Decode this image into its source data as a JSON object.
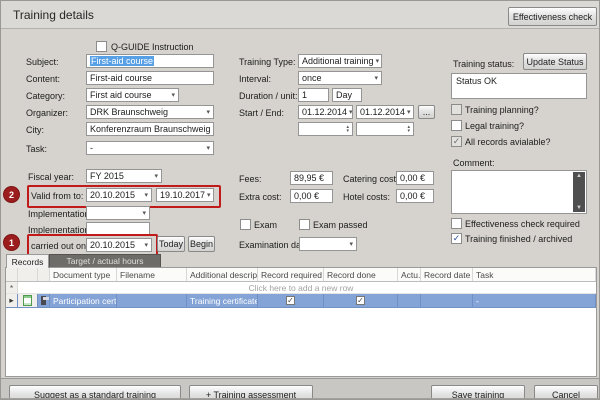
{
  "window": {
    "title": "Training details",
    "effectiveness_check_button": "Effectiveness check"
  },
  "form": {
    "qguide_label": "Q-GUIDE Instruction",
    "left": {
      "subject_label": "Subject:",
      "subject_value": "First-aid course",
      "content_label": "Content:",
      "content_value": "First-aid course",
      "category_label": "Category:",
      "category_value": "First aid course",
      "organizer_label": "Organizer:",
      "organizer_value": "DRK Braunschweig",
      "city_label": "City:",
      "city_value": "Konferenzraum Braunschweig",
      "task_label": "Task:",
      "task_value": "-",
      "fiscal_year_label": "Fiscal year:",
      "fiscal_year_value": "FY 2015",
      "valid_label": "Valid from to:",
      "valid_from": "20.10.2015",
      "valid_to": "19.10.2017",
      "implementation_to_label": "Implementation to:",
      "implementation_by_label": "Implementation by:",
      "carried_out_label": "carried out on:",
      "carried_out_value": "20.10.2015",
      "today_button": "Today",
      "begin_button": "Begin"
    },
    "middle": {
      "training_type_label": "Training Type:",
      "training_type_value": "Additional training",
      "interval_label": "Interval:",
      "interval_value": "once",
      "duration_label": "Duration / unit:",
      "duration_value": "1",
      "unit_value": "Day",
      "start_end_label": "Start / End:",
      "start_value": "01.12.2014",
      "end_value": "01.12.2014",
      "more_button": "...",
      "fees_label": "Fees:",
      "fees_value": "89,95 €",
      "extra_cost_label": "Extra cost:",
      "extra_cost_value": "0,00 €",
      "catering_label": "Catering costs:",
      "catering_value": "0,00 €",
      "hotel_label": "Hotel costs:",
      "hotel_value": "0,00 €",
      "exam_label": "Exam",
      "exam_passed_label": "Exam passed",
      "examination_date_label": "Examination date:"
    },
    "right": {
      "training_status_label": "Training status:",
      "update_status_button": "Update Status",
      "status_value": "Status OK",
      "training_planning_label": "Training planning?",
      "legal_training_label": "Legal training?",
      "all_records_label": "All records avialable?",
      "comment_label": "Comment:",
      "effectiveness_required_label": "Effectiveness check required",
      "finished_archived_label": "Training finished / archived"
    }
  },
  "annotations": {
    "marker1": "1",
    "marker2": "2"
  },
  "records": {
    "tabs": {
      "records": "Records",
      "target": "Target / actual hours"
    },
    "columns": {
      "document_type": "Document type",
      "filename": "Filename",
      "additional_description": "Additional description",
      "record_required": "Record required",
      "record_done": "Record done",
      "actual": "Actu...",
      "record_date": "Record date",
      "task": "Task"
    },
    "new_row_hint": "Click here to add a new row",
    "new_row_indicator": "*",
    "row_indicator": "▸",
    "rows": [
      {
        "document_type": "Participation certificate",
        "filename": "",
        "additional_description": "Training certificate",
        "record_required": true,
        "record_done": true,
        "actual": "",
        "record_date": "",
        "task": "-"
      }
    ]
  },
  "footer": {
    "suggest_button": "Suggest as a standard training",
    "assessment_button": "+ Training assessment",
    "save_button": "Save training",
    "cancel_button": "Cancel"
  },
  "colors": {
    "accent_red": "#c11a1a",
    "marker_red": "#9c1d1d",
    "selection_blue": "#84a3d6",
    "text_selection": "#58a0e6"
  }
}
